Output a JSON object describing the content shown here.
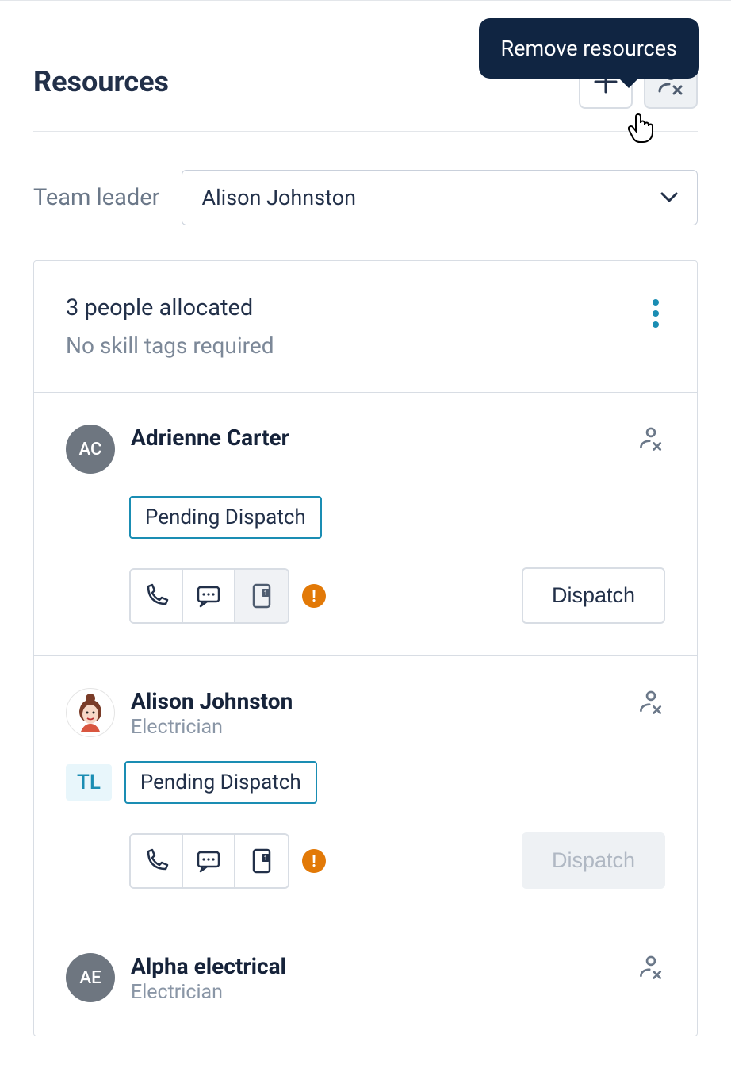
{
  "header": {
    "title": "Resources",
    "tooltip": "Remove resources"
  },
  "team_leader": {
    "label": "Team leader",
    "selected": "Alison Johnston"
  },
  "allocation": {
    "count_text": "3 people allocated",
    "subtitle": "No skill tags required"
  },
  "people": [
    {
      "initials": "AC",
      "name": "Adrienne Carter",
      "role": "",
      "tl": false,
      "status": "Pending Dispatch",
      "dispatch_label": "Dispatch",
      "dispatch_disabled": false,
      "phone_disabled": true,
      "avatar_style": "grey"
    },
    {
      "initials": "",
      "name": "Alison Johnston",
      "role": "Electrician",
      "tl": true,
      "tl_label": "TL",
      "status": "Pending Dispatch",
      "dispatch_label": "Dispatch",
      "dispatch_disabled": true,
      "phone_disabled": false,
      "avatar_style": "img"
    },
    {
      "initials": "AE",
      "name": "Alpha electrical",
      "role": "Electrician",
      "tl": false,
      "status": "",
      "avatar_style": "grey"
    }
  ]
}
